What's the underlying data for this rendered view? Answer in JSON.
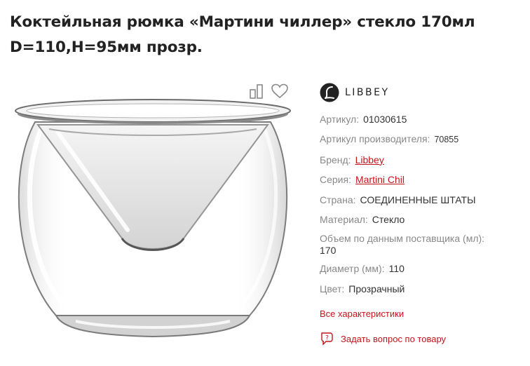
{
  "product": {
    "title": "Коктейльная рюмка «Мартини чиллер» стекло 170мл D=110,H=95мм прозр.",
    "image_icon": "martini-chiller-glass"
  },
  "actions": {
    "compare_icon": "compare-icon",
    "favorite_icon": "heart-icon"
  },
  "brand_logo": {
    "wordmark": "LIBBEY",
    "icon": "libbey-logo-icon"
  },
  "specs": {
    "article": {
      "label": "Артикул:",
      "value": "01030615"
    },
    "manufacturer_article": {
      "label": "Артикул производителя:",
      "value": "70855"
    },
    "brand": {
      "label": "Бренд:",
      "value": "Libbey"
    },
    "series": {
      "label": "Серия:",
      "value": "Martini Chil"
    },
    "country": {
      "label": "Страна:",
      "value": "СОЕДИНЕННЫЕ ШТАТЫ"
    },
    "material": {
      "label": "Материал:",
      "value": "Стекло"
    },
    "volume": {
      "label": "Объем по данным поставщика (мл):",
      "value": "170"
    },
    "diameter": {
      "label": "Диаметр (мм):",
      "value": "110"
    },
    "color": {
      "label": "Цвет:",
      "value": "Прозрачный"
    }
  },
  "links": {
    "all_specs": "Все характеристики",
    "ask_question": "Задать вопрос по товару",
    "ask_icon": "question-chat-icon"
  },
  "colors": {
    "accent": "#c4151c",
    "label": "#888888",
    "text": "#333333",
    "title": "#222222"
  }
}
